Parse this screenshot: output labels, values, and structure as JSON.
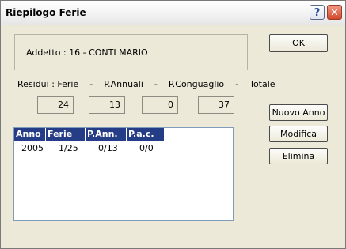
{
  "window": {
    "title": "Riepilogo Ferie",
    "help_label": "?",
    "close_label": "✕"
  },
  "addetto": {
    "label": "Addetto : 16 - CONTI MARIO"
  },
  "buttons": {
    "ok": "OK",
    "nuovo_anno": "Nuovo Anno",
    "modifica": "Modifica",
    "elimina": "Elimina"
  },
  "residui": {
    "label": "Residui : Ferie    -    P.Annuali    -    P.Conguaglio    -    Totale",
    "ferie": "24",
    "p_annuali": "13",
    "p_conguaglio": "0",
    "totale": "37"
  },
  "table": {
    "columns": [
      "Anno",
      "Ferie",
      "P.Ann.",
      "P.a.c."
    ],
    "rows": [
      [
        "2005",
        "1/25",
        "0/13",
        "0/0"
      ]
    ]
  }
}
